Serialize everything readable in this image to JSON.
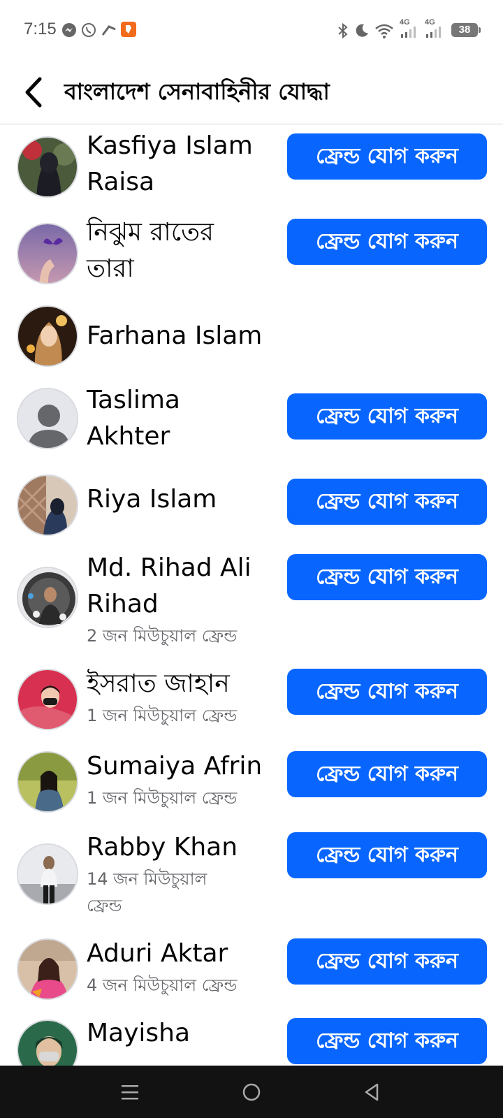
{
  "status": {
    "time": "7:15",
    "battery": "38",
    "net1": "4G",
    "net2": "4G"
  },
  "header": {
    "title": "বাংলাদেশ সেনাবাহিনীর যোদ্ধা"
  },
  "add_friend_label": "ফ্রেন্ড যোগ করুন",
  "people": [
    {
      "name": "Kasfiya Islam Raisa",
      "mutual": "",
      "show_button": true
    },
    {
      "name": "নিঝুম রাতের তারা",
      "mutual": "",
      "show_button": true
    },
    {
      "name": "Farhana Islam",
      "mutual": "",
      "show_button": false
    },
    {
      "name": "Taslima Akhter",
      "mutual": "",
      "show_button": true
    },
    {
      "name": "Riya Islam",
      "mutual": "",
      "show_button": true
    },
    {
      "name": "Md. Rihad Ali Rihad",
      "mutual": "2 জন মিউচুয়াল ফ্রেন্ড",
      "show_button": true
    },
    {
      "name": "ইসরাত জাহান",
      "mutual": "1 জন মিউচুয়াল ফ্রেন্ড",
      "show_button": true
    },
    {
      "name": "Sumaiya Afrin",
      "mutual": "1 জন মিউচুয়াল ফ্রেন্ড",
      "show_button": true
    },
    {
      "name": "Rabby Khan",
      "mutual": "14 জন মিউচুয়াল ফ্রেন্ড",
      "show_button": true
    },
    {
      "name": "Aduri Aktar",
      "mutual": "4 জন মিউচুয়াল ফ্রেন্ড",
      "show_button": true
    },
    {
      "name": "Mayisha",
      "mutual": "",
      "show_button": true
    }
  ],
  "colors": {
    "button": "#0866ff",
    "mutual_text": "#65676b"
  }
}
